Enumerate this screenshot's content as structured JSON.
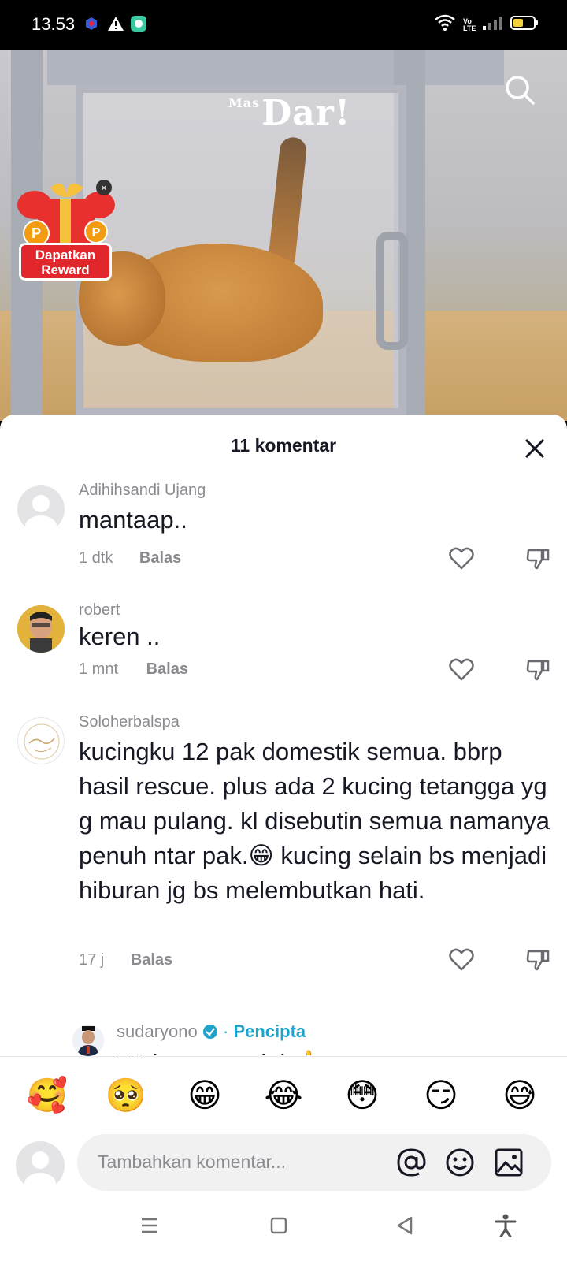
{
  "status_bar": {
    "time": "13.53",
    "volte": "Vo LTE"
  },
  "video": {
    "watermark_small": "Mas",
    "watermark": "Dar!",
    "reward_label_line1": "Dapatkan",
    "reward_label_line2": "Reward",
    "reward_close": "×"
  },
  "comments_sheet": {
    "title": "11 komentar",
    "reply_label": "Balas",
    "comments": [
      {
        "username": "Adihihsandi Ujang",
        "text": "mantaap..",
        "time": "1 dtk"
      },
      {
        "username": "robert",
        "text": "keren ..",
        "time": "1 mnt"
      },
      {
        "username": "Soloherbalspa",
        "text": "kucingku 12 pak domestik semua. bbrp hasil rescue. plus ada 2 kucing tetangga yg g mau pulang. kl disebutin semua namanya penuh ntar pak.😁 kucing selain bs menjadi hiburan jg bs melembutkan hati.",
        "time": "17 j"
      }
    ],
    "creator_reply": {
      "username": "sudaryono",
      "separator": "·",
      "tag": "Pencipta",
      "text": "Wah mantap ini 👍"
    }
  },
  "emoji_bar": [
    "🥰",
    "🥺",
    "😁",
    "😂",
    "😳",
    "😏",
    "😅"
  ],
  "comment_input": {
    "placeholder": "Tambahkan komentar..."
  },
  "colors": {
    "creator_accent": "#20a3c9",
    "reward_red": "#e1262c",
    "text_primary": "#161823",
    "text_secondary": "#8a8b91"
  }
}
